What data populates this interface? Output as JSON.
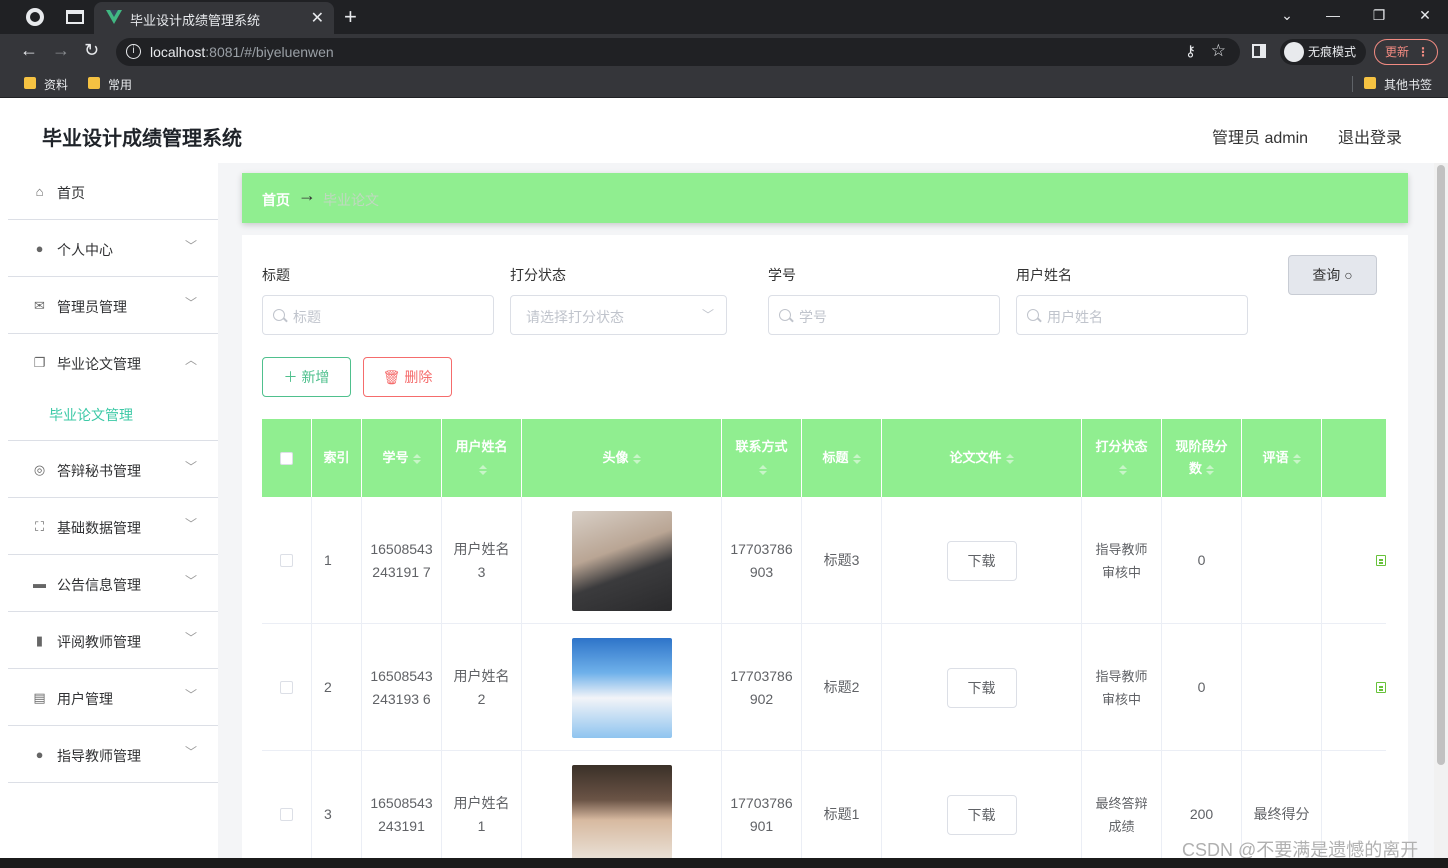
{
  "browser": {
    "tab_title": "毕业设计成绩管理系统",
    "url_host": "localhost",
    "url_rest": ":8081/#/biyeluenwen",
    "incognito_label": "无痕模式",
    "update_label": "更新",
    "bookmarks": [
      "资料",
      "常用"
    ],
    "other_bookmarks": "其他书签"
  },
  "header": {
    "title": "毕业设计成绩管理系统",
    "user": "管理员 admin",
    "logout": "退出登录"
  },
  "sidebar": {
    "items": [
      {
        "label": "首页",
        "icon": "home-icon"
      },
      {
        "label": "个人中心",
        "icon": "user-icon"
      },
      {
        "label": "管理员管理",
        "icon": "mail-icon"
      },
      {
        "label": "毕业论文管理",
        "icon": "copy-icon",
        "open": true,
        "sub": "毕业论文管理"
      },
      {
        "label": "答辩秘书管理",
        "icon": "camera-icon"
      },
      {
        "label": "基础数据管理",
        "icon": "fullscreen-icon"
      },
      {
        "label": "公告信息管理",
        "icon": "monitor-icon"
      },
      {
        "label": "评阅教师管理",
        "icon": "microphone-icon"
      },
      {
        "label": "用户管理",
        "icon": "clipboard-icon"
      },
      {
        "label": "指导教师管理",
        "icon": "bulb-icon"
      }
    ]
  },
  "breadcrumb": {
    "home": "首页",
    "separator": "→",
    "current": "毕业论文"
  },
  "filters": {
    "title_label": "标题",
    "title_placeholder": "标题",
    "status_label": "打分状态",
    "status_placeholder": "请选择打分状态",
    "id_label": "学号",
    "id_placeholder": "学号",
    "name_label": "用户姓名",
    "name_placeholder": "用户姓名",
    "query": "查询"
  },
  "actions": {
    "add": "新增",
    "delete": "删除"
  },
  "table": {
    "headers": [
      "索引",
      "学号",
      "用户姓名",
      "头像",
      "联系方式",
      "标题",
      "论文文件",
      "打分状态",
      "现阶段分数",
      "评语"
    ],
    "download_label": "下载",
    "rows": [
      {
        "index": "1",
        "student_id": "16508543243191 7",
        "name": "用户姓名3",
        "phone": "17703786903",
        "title": "标题3",
        "status": "指导教师审核中",
        "score": "0",
        "comment": ""
      },
      {
        "index": "2",
        "student_id": "16508543243193 6",
        "name": "用户姓名2",
        "phone": "17703786902",
        "title": "标题2",
        "status": "指导教师审核中",
        "score": "0",
        "comment": ""
      },
      {
        "index": "3",
        "student_id": "16508543243191",
        "name": "用户姓名1",
        "phone": "17703786901",
        "title": "标题1",
        "status": "最终答辩成绩",
        "score": "200",
        "comment": "最终得分"
      }
    ]
  },
  "watermark": "CSDN @不要满是遗憾的离开",
  "colors": {
    "accent_green": "#90ee90",
    "link_teal": "#3cc9a6",
    "danger": "#f56c6c"
  }
}
